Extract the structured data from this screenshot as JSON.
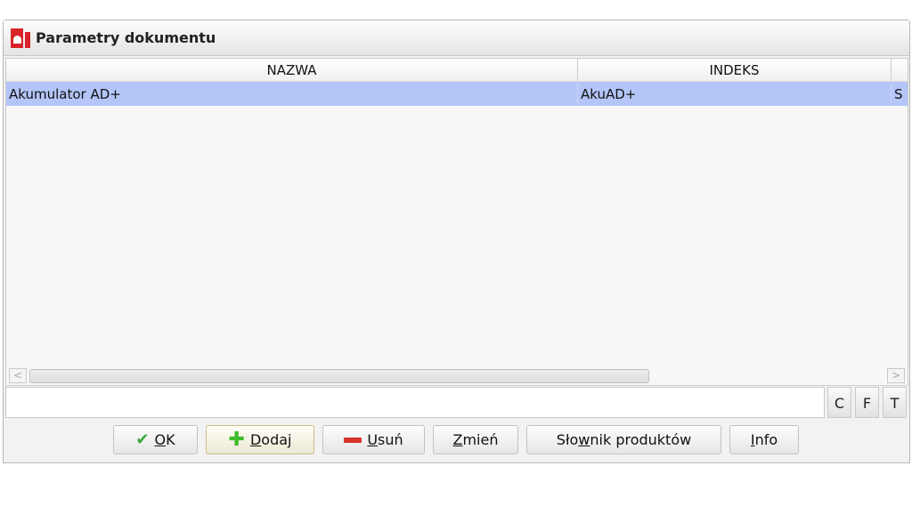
{
  "window": {
    "title": "Parametry dokumentu"
  },
  "table": {
    "columns": [
      "NAZWA",
      "INDEKS"
    ],
    "rows": [
      {
        "nazwa": "Akumulator AD+",
        "indeks": "AkuAD+",
        "extra": "S"
      }
    ]
  },
  "scrollbar": {
    "left": "<",
    "right": ">"
  },
  "filter": {
    "value": "",
    "buttons": [
      "C",
      "F",
      "T"
    ]
  },
  "buttons": {
    "ok": {
      "pre": "",
      "key": "O",
      "post": "K"
    },
    "add": {
      "pre": "",
      "key": "D",
      "post": "odaj"
    },
    "remove": {
      "pre": "",
      "key": "U",
      "post": "suń"
    },
    "edit": {
      "pre": "",
      "key": "Z",
      "post": "mień"
    },
    "dictionary": {
      "pre": "Sło",
      "key": "w",
      "post": "nik produktów"
    },
    "info": {
      "pre": "",
      "key": "I",
      "post": "nfo"
    }
  },
  "colors": {
    "selection": "#b4c6f8",
    "logo": "#d8232a",
    "ok_icon": "#3aa83a",
    "add_icon": "#3dbb2a",
    "remove_icon": "#d9342b"
  }
}
